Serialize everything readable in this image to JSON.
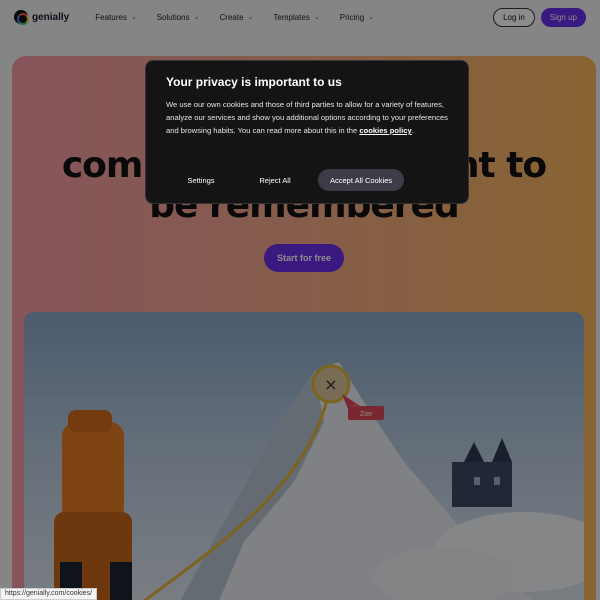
{
  "nav": {
    "brand": "genially",
    "menu": [
      {
        "label": "Features"
      },
      {
        "label": "Solutions"
      },
      {
        "label": "Create"
      },
      {
        "label": "Templates"
      },
      {
        "label": "Pricing"
      }
    ],
    "login_label": "Log in",
    "signup_label": "Sign up"
  },
  "hero": {
    "headline_line1": "communication meant to",
    "headline_line2": "be remembered",
    "start_label": "Start for free",
    "tag_label": "Zoe",
    "close_glyph": "×"
  },
  "cookie_modal": {
    "title": "Your privacy is important to us",
    "body_prefix": "We use our own cookies and those of third parties to allow for a variety of features, analyze our services and show you additional options according to your preferences and browsing habits. You can read more about this in the ",
    "link_label": "cookies policy",
    "body_suffix": ".",
    "settings_label": "Settings",
    "reject_label": "Reject All",
    "accept_label": "Accept All Cookies"
  },
  "status_bar": {
    "url": "https://genially.com/cookies/"
  },
  "colors": {
    "brand_purple": "#6a2eea",
    "modal_bg": "#141414",
    "accept_bg": "#3d3d4a",
    "tag_bg": "#e0475a"
  }
}
